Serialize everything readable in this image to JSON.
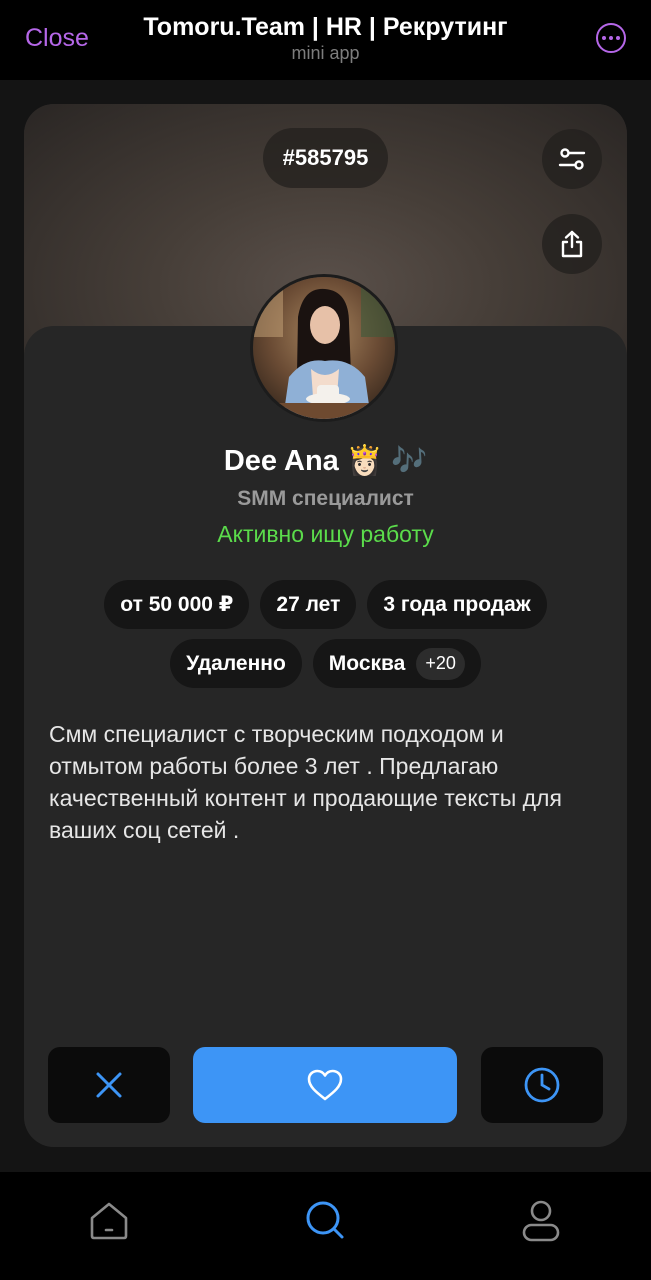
{
  "header": {
    "close_label": "Close",
    "title": "Tomoru.Team | HR | Рекрутинг",
    "subtitle": "mini app",
    "accent_color": "#b567e8"
  },
  "card": {
    "id_label": "#585795",
    "name": "Dee Ana 👸🏻 🎶",
    "role": "SMM специалист",
    "status": "Активно ищу работу",
    "status_color": "#5bdc4b",
    "chips_row1": [
      "от 50 000 ₽",
      "27 лет",
      "3 года продаж"
    ],
    "chips_row2": [
      "Удаленно",
      "Москва"
    ],
    "extra_cities": "+20",
    "description": "Смм специалист с творческим подходом и отмытом работы более 3 лет . Предлагаю качественный контент и продающие тексты для ваших соц сетей ."
  },
  "actions": {
    "reject_icon": "close-icon",
    "like_icon": "heart-icon",
    "later_icon": "clock-icon",
    "like_color": "#3d95f6",
    "icon_color": "#3d95f6"
  },
  "nav": {
    "items": [
      {
        "icon": "home-icon",
        "active": false
      },
      {
        "icon": "search-icon",
        "active": true
      },
      {
        "icon": "profile-icon",
        "active": false
      }
    ],
    "active_color": "#3d95f6",
    "inactive_color": "#8a8a8a"
  }
}
